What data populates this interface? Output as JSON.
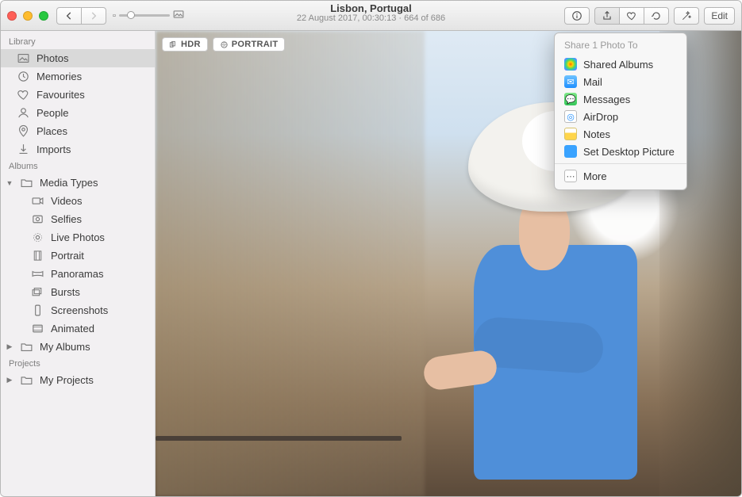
{
  "header": {
    "title": "Lisbon, Portugal",
    "subtitle": "22 August 2017, 00:30:13  ·  664 of 686",
    "edit_label": "Edit"
  },
  "badges": {
    "hdr": "HDR",
    "portrait": "PORTRAIT"
  },
  "sidebar": {
    "sections": {
      "library": "Library",
      "albums": "Albums",
      "projects": "Projects"
    },
    "library_items": [
      {
        "id": "photos",
        "label": "Photos",
        "selected": true
      },
      {
        "id": "memories",
        "label": "Memories"
      },
      {
        "id": "favourites",
        "label": "Favourites"
      },
      {
        "id": "people",
        "label": "People"
      },
      {
        "id": "places",
        "label": "Places"
      },
      {
        "id": "imports",
        "label": "Imports"
      }
    ],
    "media_types_label": "Media Types",
    "media_types": [
      {
        "id": "videos",
        "label": "Videos"
      },
      {
        "id": "selfies",
        "label": "Selfies"
      },
      {
        "id": "livephotos",
        "label": "Live Photos"
      },
      {
        "id": "portrait",
        "label": "Portrait"
      },
      {
        "id": "panoramas",
        "label": "Panoramas"
      },
      {
        "id": "bursts",
        "label": "Bursts"
      },
      {
        "id": "screenshots",
        "label": "Screenshots"
      },
      {
        "id": "animated",
        "label": "Animated"
      }
    ],
    "my_albums_label": "My Albums",
    "my_projects_label": "My Projects"
  },
  "share": {
    "header": "Share 1 Photo To",
    "items": [
      {
        "id": "shared-albums",
        "label": "Shared Albums",
        "color": "#ffffff"
      },
      {
        "id": "mail",
        "label": "Mail",
        "color": "#1f8fff"
      },
      {
        "id": "messages",
        "label": "Messages",
        "color": "#34c759"
      },
      {
        "id": "airdrop",
        "label": "AirDrop",
        "color": "#ffffff"
      },
      {
        "id": "notes",
        "label": "Notes",
        "color": "#ffd54a"
      },
      {
        "id": "desktop",
        "label": "Set Desktop Picture",
        "color": "#3aa3ff"
      }
    ],
    "more_label": "More"
  }
}
